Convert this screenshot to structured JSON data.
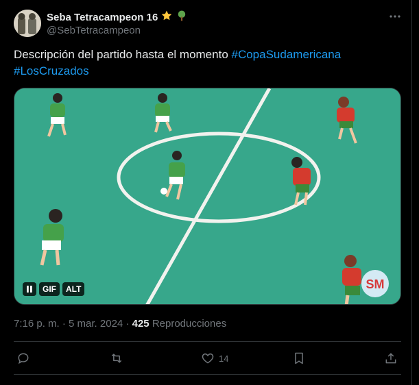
{
  "author": {
    "display_name": "Seba Tetracampeon 16",
    "handle": "@SebTetracampeon",
    "badges": [
      "star-emoji",
      "tree-emoji"
    ]
  },
  "tweet": {
    "text": "Descripción del partido hasta el momento ",
    "hashtags": [
      "#CopaSudamericana",
      "#LosCruzados"
    ]
  },
  "media": {
    "type": "gif",
    "controls": {
      "pause_icon": "pause-icon",
      "gif_label": "GIF",
      "alt_label": "ALT"
    },
    "watermark": "SM"
  },
  "meta": {
    "time": "7:16 p. m.",
    "separator": "·",
    "date": "5 mar. 2024",
    "views_count": "425",
    "views_label": "Reproducciones"
  },
  "actions": {
    "reply_icon": "reply-icon",
    "retweet_icon": "retweet-icon",
    "like_icon": "heart-icon",
    "like_count": "14",
    "bookmark_icon": "bookmark-icon",
    "share_icon": "share-icon"
  },
  "colors": {
    "background": "#000000",
    "text": "#e7e9ea",
    "secondary": "#71767b",
    "link": "#1d9bf0",
    "pitch": "#37a78b"
  }
}
